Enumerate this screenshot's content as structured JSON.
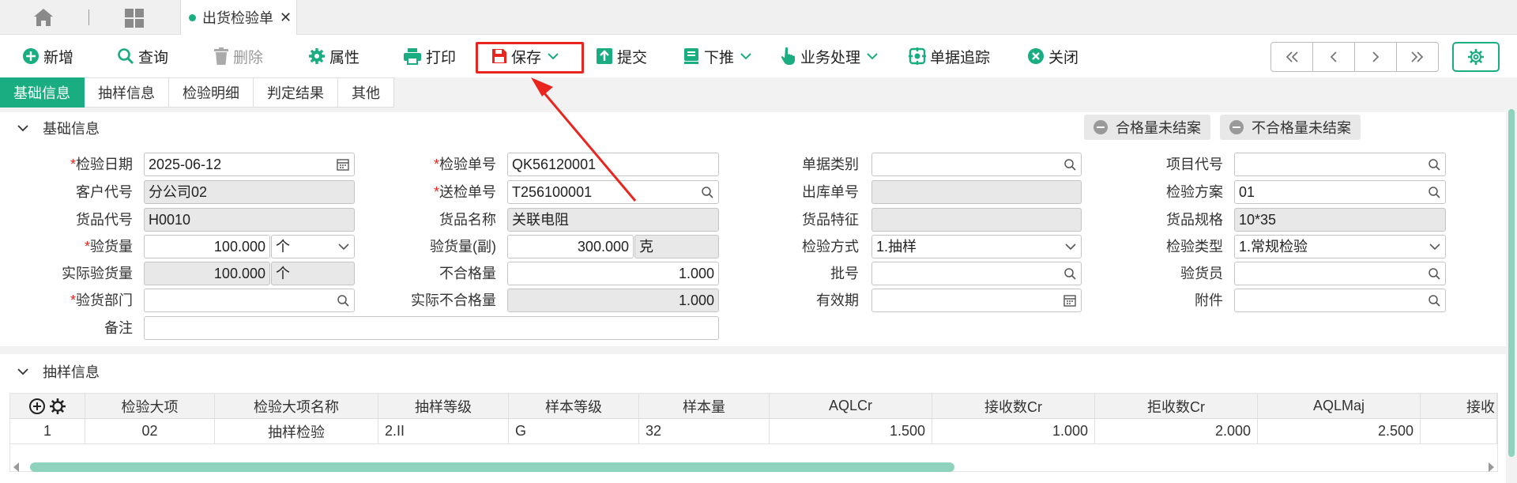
{
  "tabs": {
    "active_tab": "出货检验单",
    "close": "✕"
  },
  "toolbar": {
    "new": "新增",
    "query": "查询",
    "delete": "删除",
    "props": "属性",
    "print": "打印",
    "save": "保存",
    "submit": "提交",
    "push": "下推",
    "business": "业务处理",
    "trace": "单据追踪",
    "close": "关闭"
  },
  "subtabs": [
    "基础信息",
    "抽样信息",
    "检验明细",
    "判定结果",
    "其他"
  ],
  "basic": {
    "title": "基础信息",
    "pill_ok": "合格量未结案",
    "pill_ng": "不合格量未结案",
    "fields": {
      "inspect_date": {
        "label": "检验日期",
        "value": "2025-06-12"
      },
      "customer": {
        "label": "客户代号",
        "value": "分公司02"
      },
      "goods_code": {
        "label": "货品代号",
        "value": "H0010"
      },
      "inspect_qty": {
        "label": "验货量",
        "value": "100.000",
        "unit": "个"
      },
      "actual_qty": {
        "label": "实际验货量",
        "value": "100.000",
        "unit": "个"
      },
      "dept": {
        "label": "验货部门",
        "value": ""
      },
      "remark": {
        "label": "备注",
        "value": ""
      },
      "inspect_no": {
        "label": "检验单号",
        "value": "QK56120001"
      },
      "send_no": {
        "label": "送检单号",
        "value": "T256100001"
      },
      "goods_name": {
        "label": "货品名称",
        "value": "关联电阻"
      },
      "qty_sub": {
        "label": "验货量(副)",
        "value": "300.000",
        "unit": "克"
      },
      "ng_qty": {
        "label": "不合格量",
        "value": "1.000"
      },
      "actual_ng": {
        "label": "实际不合格量",
        "value": "1.000"
      },
      "doc_type": {
        "label": "单据类别",
        "value": ""
      },
      "out_no": {
        "label": "出库单号",
        "value": ""
      },
      "goods_feature": {
        "label": "货品特征",
        "value": ""
      },
      "method": {
        "label": "检验方式",
        "value": "1.抽样"
      },
      "batch": {
        "label": "批号",
        "value": ""
      },
      "expiry": {
        "label": "有效期",
        "value": ""
      },
      "project": {
        "label": "项目代号",
        "value": ""
      },
      "plan": {
        "label": "检验方案",
        "value": "01"
      },
      "spec": {
        "label": "货品规格",
        "value": "10*35"
      },
      "type": {
        "label": "检验类型",
        "value": "1.常规检验"
      },
      "inspector": {
        "label": "验货员",
        "value": ""
      },
      "attach": {
        "label": "附件",
        "value": ""
      }
    }
  },
  "sampling": {
    "title": "抽样信息",
    "columns": [
      "检验大项",
      "检验大项名称",
      "抽样等级",
      "样本等级",
      "样本量",
      "AQLCr",
      "接收数Cr",
      "拒收数Cr",
      "AQLMaj",
      "接收"
    ],
    "rows": [
      [
        "1",
        "02",
        "抽样检验",
        "2.II",
        "G",
        "32",
        "1.500",
        "1.000",
        "2.000",
        "2.500",
        ""
      ]
    ]
  },
  "colors": {
    "accent": "#1aad81",
    "highlight": "#e8251e"
  }
}
